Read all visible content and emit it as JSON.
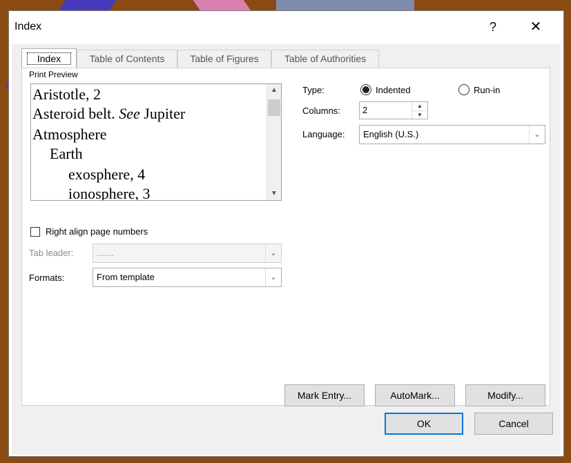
{
  "dialog": {
    "title": "Index",
    "help_label": "?",
    "close_label": "✕"
  },
  "tabs": [
    {
      "label": "Index",
      "active": true
    },
    {
      "label": "Table of Contents"
    },
    {
      "label": "Table of Figures"
    },
    {
      "label": "Table of Authorities"
    }
  ],
  "preview": {
    "label": "Print Preview",
    "lines": [
      {
        "text": "Aristotle, 2"
      },
      {
        "prefix": "Asteroid belt. ",
        "italic": "See",
        "suffix": " Jupiter"
      },
      {
        "text": "Atmosphere"
      },
      {
        "text": "Earth"
      },
      {
        "text": "exosphere, 4"
      },
      {
        "text": "ionosphere, 3"
      }
    ]
  },
  "type": {
    "label": "Type:",
    "options": [
      "Indented",
      "Run-in"
    ],
    "selected": "Indented"
  },
  "columns": {
    "label": "Columns:",
    "value": "2"
  },
  "language": {
    "label": "Language:",
    "value": "English (U.S.)"
  },
  "right_align": {
    "label": "Right align page numbers",
    "checked": false
  },
  "tab_leader": {
    "label": "Tab leader:",
    "value": ".......",
    "disabled": true
  },
  "formats": {
    "label": "Formats:",
    "value": "From template"
  },
  "buttons": {
    "mark_entry": "Mark Entry...",
    "automark": "AutoMark...",
    "modify": "Modify...",
    "ok": "OK",
    "cancel": "Cancel"
  },
  "colors": {
    "frame": "#8a4a14",
    "accent": "#0078d7"
  }
}
